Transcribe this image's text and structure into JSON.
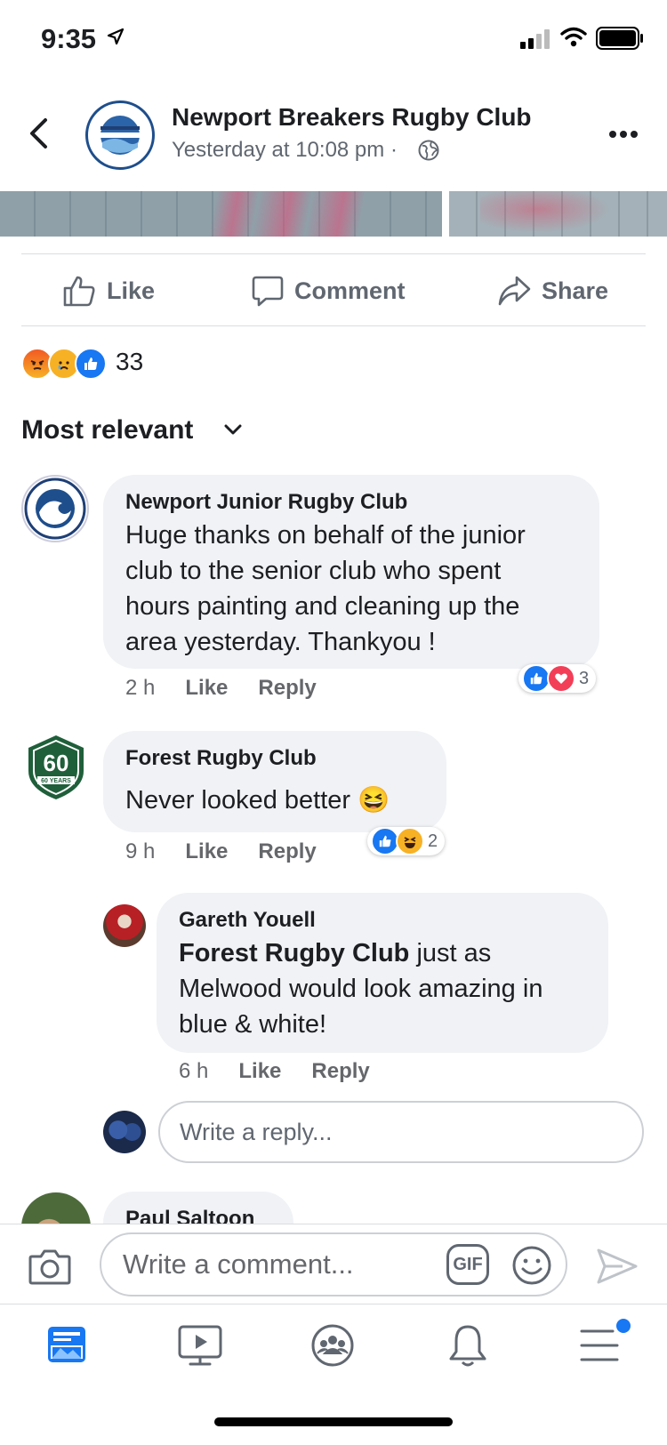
{
  "status": {
    "time": "9:35"
  },
  "header": {
    "title": "Newport Breakers Rugby Club",
    "subtitle": "Yesterday at 10:08 pm ·",
    "logo_text_top": "NEWPORT RUGBY CLUB",
    "logo_text_bottom": "BREAKERS"
  },
  "actions": {
    "like": "Like",
    "comment": "Comment",
    "share": "Share"
  },
  "reactions": {
    "count": "33",
    "types": [
      "angry",
      "sad",
      "like"
    ]
  },
  "sort": {
    "label": "Most relevant"
  },
  "comments": [
    {
      "name": "Newport Junior Rugby Club",
      "text_lines": [
        "Huge thanks on behalf of the junior",
        "club to the senior club who spent",
        "hours painting and cleaning up the",
        "area yesterday. Thankyou !"
      ],
      "time": "2 h",
      "like": "Like",
      "reply": "Reply",
      "reaction_count": "3",
      "reaction_types": [
        "like",
        "love"
      ],
      "logo_text": "NEWPORT RUGBY CLUB"
    },
    {
      "name": "Forest Rugby Club",
      "text": "Never looked better",
      "emoji": "😆",
      "time": "9 h",
      "like": "Like",
      "reply": "Reply",
      "reaction_count": "2",
      "reaction_types": [
        "like",
        "haha"
      ],
      "logo_text": "60 YEARS"
    }
  ],
  "reply_comment": {
    "name": "Gareth Youell",
    "mention": "Forest Rugby Club",
    "text_first": " just as",
    "text_lines": [
      "Melwood would look amazing in",
      "blue & white!"
    ],
    "time": "6 h",
    "like": "Like",
    "reply": "Reply"
  },
  "reply_input": {
    "placeholder": "Write a reply..."
  },
  "partial_comment": {
    "name": "Paul Saltoon"
  },
  "comment_bar": {
    "placeholder": "Write a comment...",
    "gif": "GIF"
  },
  "colors": {
    "brand": "#1877f2",
    "text": "#1c1e21",
    "secondary": "#606770",
    "bubble": "#f0f2f5",
    "love": "#f33e58",
    "angry": "#e9710f",
    "haha": "#f7b125"
  },
  "tabs": [
    "news-feed-icon",
    "watch-icon",
    "groups-icon",
    "notifications-icon",
    "menu-icon"
  ]
}
